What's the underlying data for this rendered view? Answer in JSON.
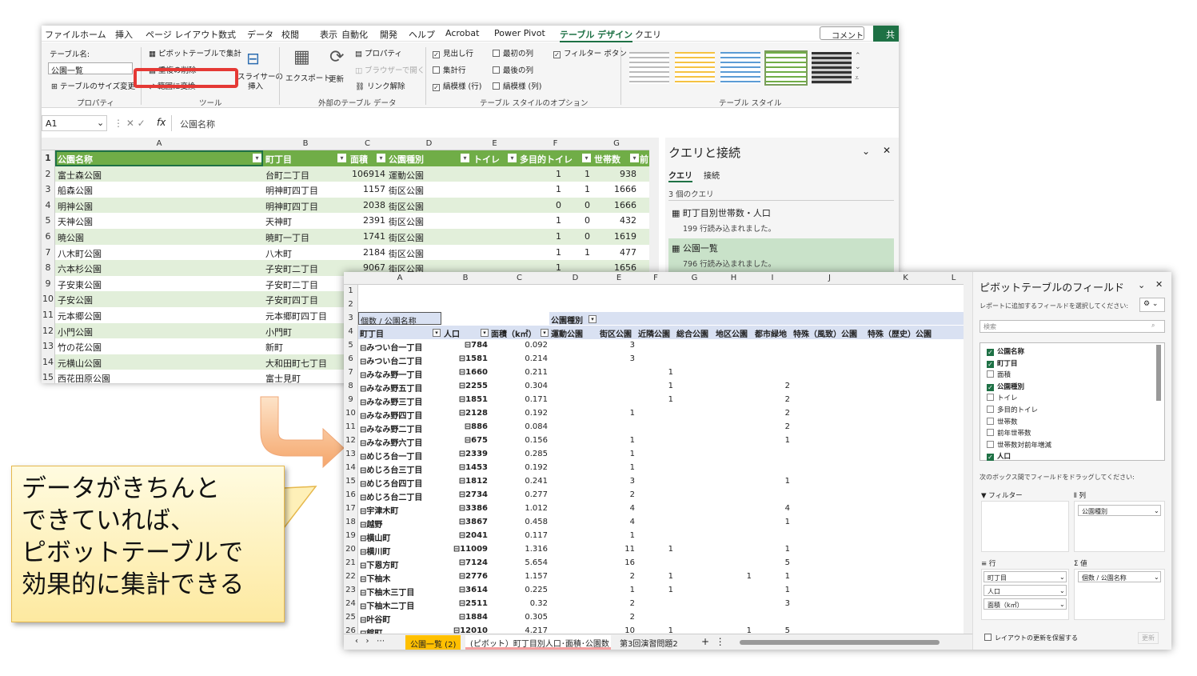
{
  "menu": [
    "ファイル",
    "ホーム",
    "挿入",
    "ページ レイアウト",
    "数式",
    "データ",
    "校閲",
    "表示",
    "自動化",
    "開発",
    "ヘルプ",
    "Acrobat",
    "Power Pivot",
    "テーブル デザイン",
    "クエリ"
  ],
  "comment_btn": "コメント",
  "share_btn": "共",
  "ribbon": {
    "table_name_label": "テーブル名:",
    "table_name_value": "公園一覧",
    "resize": "テーブルのサイズ変更",
    "grp_props": "プロパティ",
    "pivot": "ピボットテーブルで集計",
    "remove_dup": "重複の削除",
    "convert_range": "範囲に変換",
    "slicer": "スライサーの",
    "slicer2": "挿入",
    "grp_tools": "ツール",
    "export": "エクスポート",
    "refresh": "更新",
    "properties": "プロパティ",
    "browser": "ブラウザーで開く",
    "unlink": "リンク解除",
    "grp_ext": "外部のテーブル データ",
    "opt_header": "見出し行",
    "opt_first": "最初の列",
    "opt_filter": "フィルター ボタン",
    "opt_total": "集計行",
    "opt_last": "最後の列",
    "opt_banded_r": "縞模様 (行)",
    "opt_banded_c": "縞模様 (列)",
    "grp_opts": "テーブル スタイルのオプション",
    "grp_styles": "テーブル スタイル"
  },
  "namebox": "A1",
  "formula": "公園名称",
  "cols1": [
    "A",
    "B",
    "C",
    "D",
    "E",
    "F",
    "G"
  ],
  "hdr1": [
    "公園名称",
    "町丁目",
    "面積",
    "公園種別",
    "トイレ",
    "多目的トイレ",
    "世帯数",
    "前"
  ],
  "rows1": [
    [
      "2",
      "富士森公園",
      "台町二丁目",
      "106914",
      "運動公園",
      "1",
      "1",
      "938"
    ],
    [
      "3",
      "船森公園",
      "明神町四丁目",
      "1157",
      "街区公園",
      "1",
      "1",
      "1666"
    ],
    [
      "4",
      "明神公園",
      "明神町四丁目",
      "2038",
      "街区公園",
      "0",
      "0",
      "1666"
    ],
    [
      "5",
      "天神公園",
      "天神町",
      "2391",
      "街区公園",
      "1",
      "0",
      "432"
    ],
    [
      "6",
      "暁公園",
      "暁町一丁目",
      "1741",
      "街区公園",
      "1",
      "0",
      "1619"
    ],
    [
      "7",
      "八木町公園",
      "八木町",
      "2184",
      "街区公園",
      "1",
      "1",
      "477"
    ],
    [
      "8",
      "六本杉公園",
      "子安町二丁目",
      "9067",
      "街区公園",
      "1",
      "",
      "1656"
    ],
    [
      "9",
      "子安東公園",
      "子安町二丁目",
      "",
      "",
      "",
      "",
      ""
    ],
    [
      "10",
      "子安公園",
      "子安町四丁目",
      "",
      "",
      "",
      "",
      ""
    ],
    [
      "11",
      "元本郷公園",
      "元本郷町四丁目",
      "",
      "",
      "",
      "",
      ""
    ],
    [
      "12",
      "小門公園",
      "小門町",
      "",
      "",
      "",
      "",
      ""
    ],
    [
      "13",
      "竹の花公園",
      "新町",
      "",
      "",
      "",
      "",
      ""
    ],
    [
      "14",
      "元横山公園",
      "大和田町七丁目",
      "",
      "",
      "",
      "",
      ""
    ],
    [
      "15",
      "西花田原公園",
      "富士見町",
      "",
      "",
      "",
      "",
      ""
    ]
  ],
  "query": {
    "title": "クエリと接続",
    "tab1": "クエリ",
    "tab2": "接続",
    "count": "3 個のクエリ",
    "q1": "町丁目別世帯数・人口",
    "q1s": "199 行読み込まれました。",
    "q2": "公園一覧",
    "q2s": "796 行読み込まれました。"
  },
  "cols2": [
    "A",
    "B",
    "C",
    "D",
    "E",
    "F",
    "G",
    "H",
    "I",
    "J",
    "K",
    "L"
  ],
  "pivot": {
    "corner": "個数 / 公園名称",
    "colfield": "公園種別",
    "rowhdr": [
      "町丁目",
      "人口",
      "面積（k㎡）"
    ],
    "types": [
      "運動公園",
      "街区公園",
      "近隣公園",
      "総合公園",
      "地区公園",
      "都市緑地",
      "特殊（風致）公園",
      "特殊（歴史）公園"
    ],
    "rows": [
      [
        "5",
        "みつい台一丁目",
        "784",
        "0.092",
        "",
        "3",
        "",
        "",
        "",
        "",
        "",
        ""
      ],
      [
        "6",
        "みつい台二丁目",
        "1581",
        "0.214",
        "",
        "3",
        "",
        "",
        "",
        "",
        "",
        ""
      ],
      [
        "7",
        "みなみ野一丁目",
        "1660",
        "0.211",
        "",
        "",
        "1",
        "",
        "",
        "",
        "",
        ""
      ],
      [
        "8",
        "みなみ野五丁目",
        "2255",
        "0.304",
        "",
        "",
        "1",
        "",
        "",
        "2",
        "",
        ""
      ],
      [
        "9",
        "みなみ野三丁目",
        "1851",
        "0.171",
        "",
        "",
        "1",
        "",
        "",
        "2",
        "",
        ""
      ],
      [
        "10",
        "みなみ野四丁目",
        "2128",
        "0.192",
        "",
        "1",
        "",
        "",
        "",
        "2",
        "",
        ""
      ],
      [
        "11",
        "みなみ野二丁目",
        "886",
        "0.084",
        "",
        "",
        "",
        "",
        "",
        "2",
        "",
        ""
      ],
      [
        "12",
        "みなみ野六丁目",
        "675",
        "0.156",
        "",
        "1",
        "",
        "",
        "",
        "1",
        "",
        ""
      ],
      [
        "13",
        "めじろ台一丁目",
        "2339",
        "0.285",
        "",
        "1",
        "",
        "",
        "",
        "",
        "",
        ""
      ],
      [
        "14",
        "めじろ台三丁目",
        "1453",
        "0.192",
        "",
        "1",
        "",
        "",
        "",
        "",
        "",
        ""
      ],
      [
        "15",
        "めじろ台四丁目",
        "1812",
        "0.241",
        "",
        "3",
        "",
        "",
        "",
        "1",
        "",
        ""
      ],
      [
        "16",
        "めじろ台二丁目",
        "2734",
        "0.277",
        "",
        "2",
        "",
        "",
        "",
        "",
        "",
        ""
      ],
      [
        "17",
        "宇津木町",
        "3386",
        "1.012",
        "",
        "4",
        "",
        "",
        "",
        "4",
        "",
        ""
      ],
      [
        "18",
        "越野",
        "3867",
        "0.458",
        "",
        "4",
        "",
        "",
        "",
        "1",
        "",
        ""
      ],
      [
        "19",
        "横山町",
        "2041",
        "0.117",
        "",
        "1",
        "",
        "",
        "",
        "",
        "",
        ""
      ],
      [
        "20",
        "横川町",
        "11009",
        "1.316",
        "",
        "11",
        "1",
        "",
        "",
        "1",
        "",
        ""
      ],
      [
        "21",
        "下恩方町",
        "7124",
        "5.654",
        "",
        "16",
        "",
        "",
        "",
        "5",
        "",
        ""
      ],
      [
        "22",
        "下柚木",
        "2776",
        "1.157",
        "",
        "2",
        "1",
        "",
        "1",
        "1",
        "",
        ""
      ],
      [
        "23",
        "下柚木三丁目",
        "3614",
        "0.225",
        "",
        "1",
        "1",
        "",
        "",
        "1",
        "",
        ""
      ],
      [
        "24",
        "下柚木二丁目",
        "2511",
        "0.32",
        "",
        "2",
        "",
        "",
        "",
        "3",
        "",
        ""
      ],
      [
        "25",
        "叶谷町",
        "1884",
        "0.305",
        "",
        "2",
        "",
        "",
        "",
        "",
        "",
        ""
      ],
      [
        "26",
        "館町",
        "12010",
        "4.217",
        "",
        "10",
        "1",
        "",
        "1",
        "5",
        "",
        ""
      ]
    ]
  },
  "fields": {
    "title": "ピボットテーブルのフィールド",
    "sub": "レポートに追加するフィールドを選択してください:",
    "search": "検索",
    "list": [
      [
        "公園名称",
        true
      ],
      [
        "町丁目",
        true
      ],
      [
        "面積",
        false
      ],
      [
        "公園種別",
        true
      ],
      [
        "トイレ",
        false
      ],
      [
        "多目的トイレ",
        false
      ],
      [
        "世帯数",
        false
      ],
      [
        "前年世帯数",
        false
      ],
      [
        "世帯数対前年増減",
        false
      ],
      [
        "人口",
        true
      ]
    ],
    "drag": "次のボックス間でフィールドをドラッグしてください:",
    "filter": "フィルター",
    "col": "列",
    "row": "行",
    "val": "値",
    "colitem": "公園種別",
    "rowitems": [
      "町丁目",
      "人口",
      "面積（k㎡）"
    ],
    "valitem": "個数 / 公園名称",
    "defer": "レイアウトの更新を保留する",
    "update": "更新"
  },
  "tabs": {
    "t1": "公園一覧 (2)",
    "t2": "(ピボット）町丁目別人口･面積･公園数",
    "t3": "第3回演習問題2"
  },
  "callout": [
    "データがきちんと",
    "できていれば、",
    "ピボットテーブルで",
    "効果的に集計できる"
  ]
}
